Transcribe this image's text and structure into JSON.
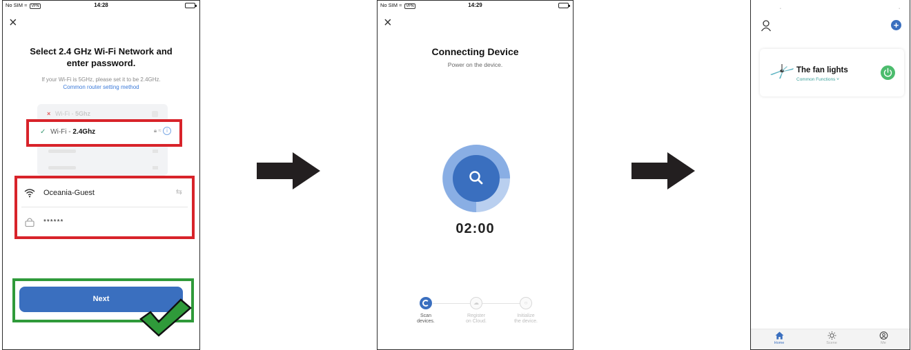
{
  "screen1": {
    "status": {
      "carrier": "No SIM",
      "vpn": "VPN",
      "time": "14:28"
    },
    "title_line1": "Select 2.4 GHz Wi-Fi Network and",
    "title_line2": "enter password.",
    "subtitle": "If your Wi-Fi is 5GHz, please set it to be 2.4GHz.",
    "link": "Common router setting method",
    "network_5g": {
      "prefix": "Wi-Fi - ",
      "band": "5Ghz"
    },
    "network_24g": {
      "prefix": "Wi-Fi - ",
      "band": "2.4Ghz"
    },
    "ssid": "Oceania-Guest",
    "password_masked": "******",
    "next_label": "Next"
  },
  "screen2": {
    "status": {
      "carrier": "No SIM",
      "vpn": "VPN",
      "time": "14:29"
    },
    "title": "Connecting Device",
    "subtitle": "Power on the device.",
    "timer": "02:00",
    "steps": [
      {
        "line1": "Scan",
        "line2": "devices."
      },
      {
        "line1": "Register",
        "line2": "on Cloud."
      },
      {
        "line1": "Initialize",
        "line2": "the device."
      }
    ]
  },
  "screen3": {
    "device_name": "The fan lights",
    "device_functions": "Common Functions ˅",
    "tabs": [
      "Home",
      "Scene",
      "Me"
    ],
    "accent": "#3a6fbf",
    "power_color": "#4cbc6d"
  },
  "colors": {
    "red_highlight": "#d8232a",
    "green_highlight": "#2f9a3a"
  }
}
